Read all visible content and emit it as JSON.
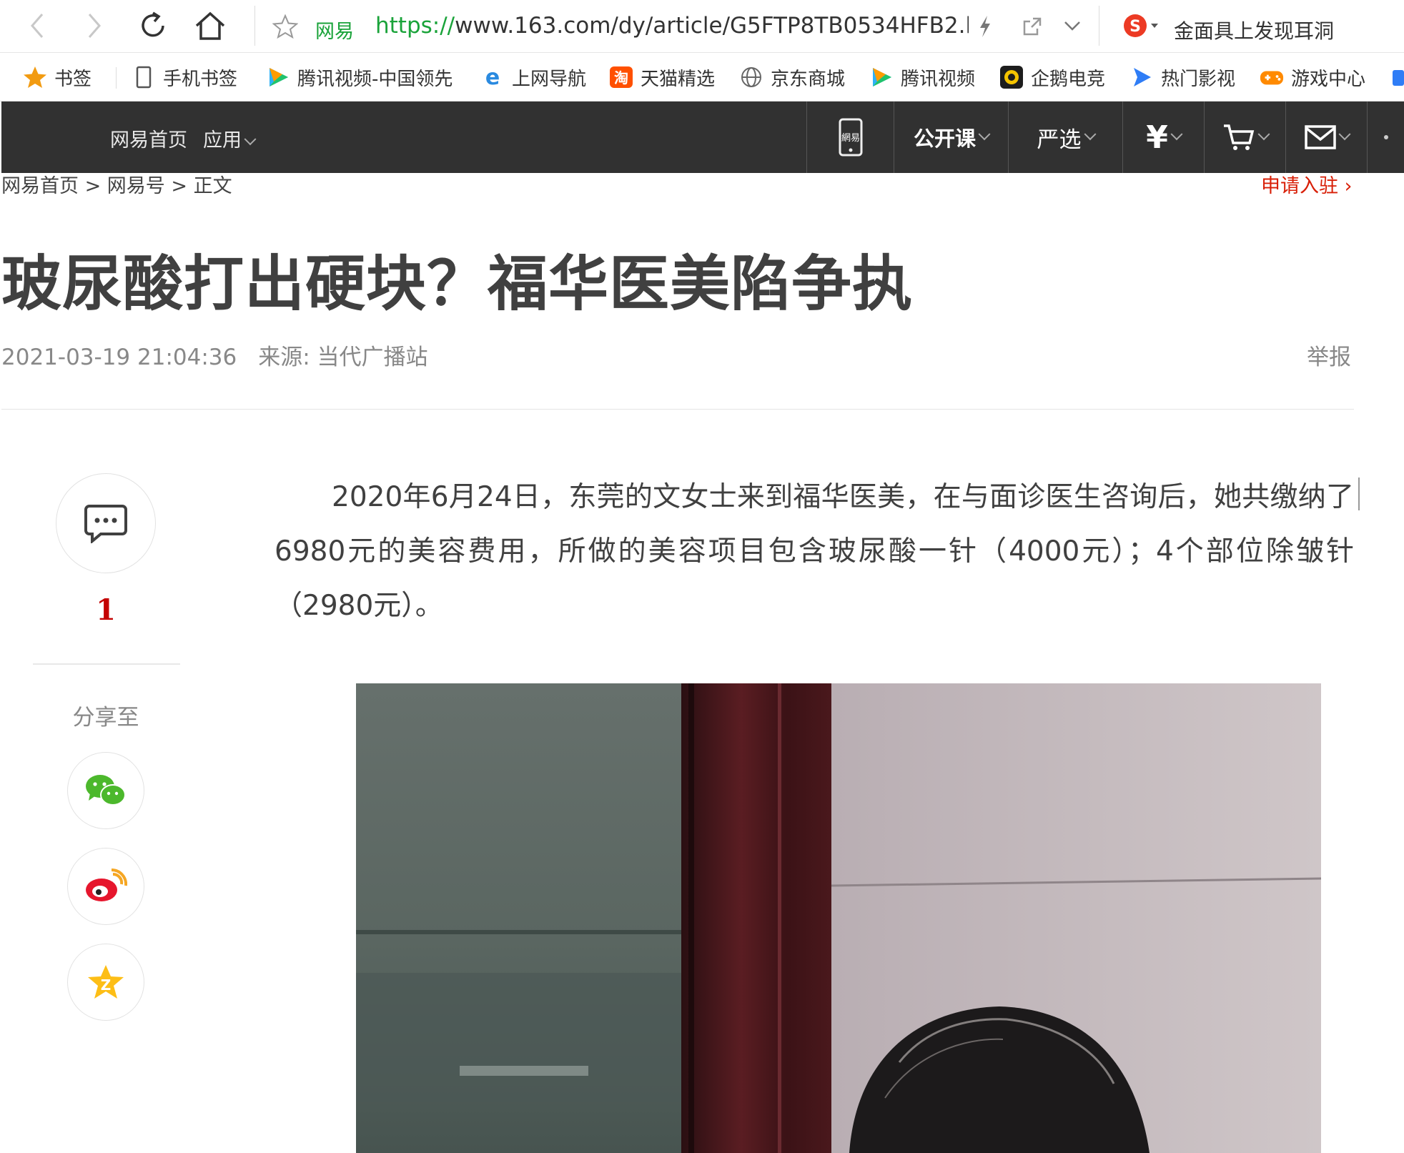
{
  "browser": {
    "site_label": "网易",
    "url_protocol": "https://",
    "url_rest": "www.163.com/dy/article/G5FTP8TB0534HFB2.l",
    "search_text": "金面具上发现耳洞"
  },
  "bookmarks": [
    {
      "label": "书签",
      "icon": "star-icon"
    },
    {
      "label": "手机书签",
      "icon": "phone-icon"
    },
    {
      "label": "腾讯视频-中国领先",
      "icon": "tencent-video-icon"
    },
    {
      "label": "上网导航",
      "icon": "ie-icon"
    },
    {
      "label": "天猫精选",
      "icon": "taobao-icon"
    },
    {
      "label": "京东商城",
      "icon": "globe-icon"
    },
    {
      "label": "腾讯视频",
      "icon": "tencent-video-icon"
    },
    {
      "label": "企鹅电竞",
      "icon": "penguin-esports-icon"
    },
    {
      "label": "热门影视",
      "icon": "movie-icon"
    },
    {
      "label": "游戏中心",
      "icon": "gamepad-icon"
    }
  ],
  "sitenav": {
    "home": "网易首页",
    "apps": "应用",
    "open_course": "公开课",
    "yanxuan": "严选"
  },
  "breadcrumb": {
    "home": "网易首页",
    "sep1": " > ",
    "section": "网易号",
    "sep2": " > ",
    "current": "正文"
  },
  "apply_link": "申请入驻 ›",
  "article": {
    "title": "玻尿酸打出硬块？福华医美陷争执",
    "datetime": "2021-03-19 21:04:36",
    "source": "来源: 当代广播站",
    "report": "举报",
    "paragraph": "2020年6月24日，东莞的文女士来到福华医美，在与面诊医生咨询后，她共缴纳了6980元的美容费用，所做的美容项目包含玻尿酸一针（4000元）；4个部位除皱针（2980元）。"
  },
  "sidebar": {
    "comment_count": "1",
    "share_label": "分享至"
  },
  "colors": {
    "nav_bg": "#313131",
    "accent_red": "#d81e06",
    "url_green": "#1aa33a"
  }
}
